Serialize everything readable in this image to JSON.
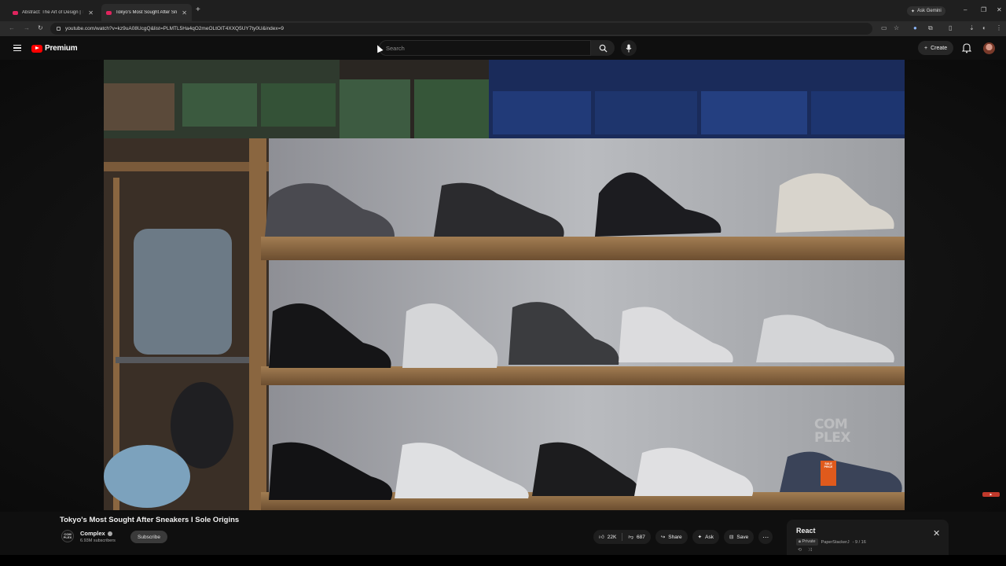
{
  "browser": {
    "tabs": [
      {
        "title": "Abstract: The Art of Design | Tr",
        "active": false
      },
      {
        "title": "Tokyo's Most Sought After Sne",
        "active": true
      }
    ],
    "ask_gemini": "Ask Gemini",
    "url": "youtube.com/watch?v=kz9uA08UcgQ&list=PLMTL5Ha4qO2meOLtOIT4XXQ5UY7ty0U&index=9"
  },
  "header": {
    "brand": "Premium",
    "search_placeholder": "Search",
    "create_label": "Create"
  },
  "video": {
    "watermark_line1": "COM",
    "watermark_line2": "PLEX",
    "sale_tag": "SALE PRICE",
    "title": "Tokyo's Most Sought After Sneakers I Sole Origins",
    "channel": {
      "avatar_text": "COM PLEX",
      "name": "Complex",
      "subscribers": "6.93M subscribers",
      "subscribe_label": "Subscribe"
    },
    "actions": {
      "likes": "22K",
      "dislikes": "687",
      "share": "Share",
      "ask": "Ask",
      "save": "Save"
    }
  },
  "playlist": {
    "title": "React",
    "privacy": "Private",
    "owner": "PaperStackerJ",
    "position": "- 9 / 16"
  },
  "colors": {
    "accent": "#ff0000",
    "background": "#0f0f0f"
  }
}
